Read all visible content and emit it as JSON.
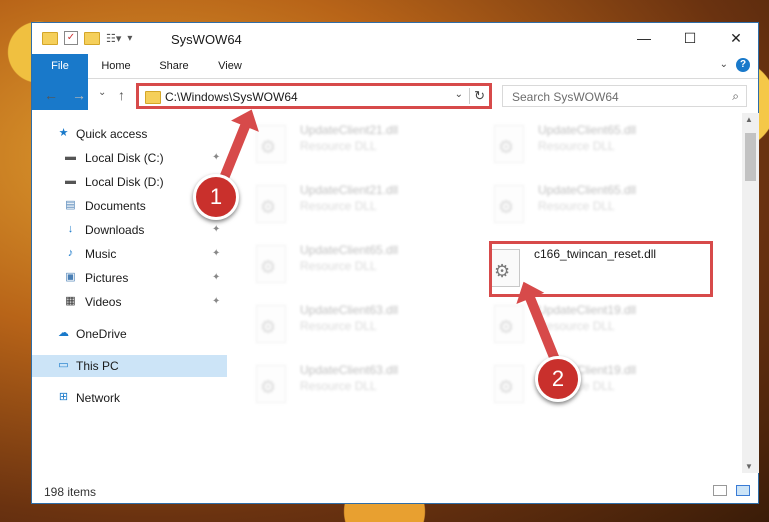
{
  "window": {
    "title": "SysWOW64",
    "minimize": "—",
    "maximize": "☐",
    "close": "✕"
  },
  "ribbon": {
    "tabs": [
      "File",
      "Home",
      "Share",
      "View"
    ],
    "help": "?"
  },
  "nav": {
    "back": "←",
    "forward": "→",
    "recent": "⌄",
    "up": "↑"
  },
  "address": {
    "path": "C:\\Windows\\SysWOW64",
    "dropdown": "⌄",
    "refresh": "↻"
  },
  "search": {
    "placeholder": "Search SysWOW64",
    "icon": "⌕"
  },
  "sidebar": {
    "items": [
      {
        "label": "Quick access",
        "icon": "★"
      },
      {
        "label": "Local Disk (C:)",
        "icon": "▬",
        "pinned": true
      },
      {
        "label": "Local Disk (D:)",
        "icon": "▬"
      },
      {
        "label": "Documents",
        "icon": "▤"
      },
      {
        "label": "Downloads",
        "icon": "↓",
        "pinned": true
      },
      {
        "label": "Music",
        "icon": "♪",
        "pinned": true
      },
      {
        "label": "Pictures",
        "icon": "▣",
        "pinned": true
      },
      {
        "label": "Videos",
        "icon": "▦",
        "pinned": true
      },
      {
        "label": "OneDrive",
        "icon": "☁"
      },
      {
        "label": "This PC",
        "icon": "▭"
      },
      {
        "label": "Network",
        "icon": "⊞"
      }
    ],
    "pin_glyph": "📌"
  },
  "files": [
    {
      "name": "UpdateClient21.dll",
      "type": "Resource DLL"
    },
    {
      "name": "UpdateClient65.dll",
      "type": "Resource DLL"
    },
    {
      "name": "UpdateClient21.dll",
      "type": "Resource DLL"
    },
    {
      "name": "UpdateClient65.dll",
      "type": "Resource DLL"
    },
    {
      "name": "UpdateClient65.dll",
      "type": "Resource DLL"
    },
    {
      "name": "c166_twincan_reset.dll",
      "type": ""
    },
    {
      "name": "UpdateClient63.dll",
      "type": "Resource DLL"
    },
    {
      "name": "UpdateClient19.dll",
      "type": "Resource DLL"
    },
    {
      "name": "UpdateClient63.dll",
      "type": "Resource DLL"
    },
    {
      "name": "UpdateClient19.dll",
      "type": "Resource DLL"
    }
  ],
  "status": {
    "count": "198 items"
  },
  "annotations": {
    "step1": "1",
    "step2": "2",
    "color": "#d74a4a"
  }
}
